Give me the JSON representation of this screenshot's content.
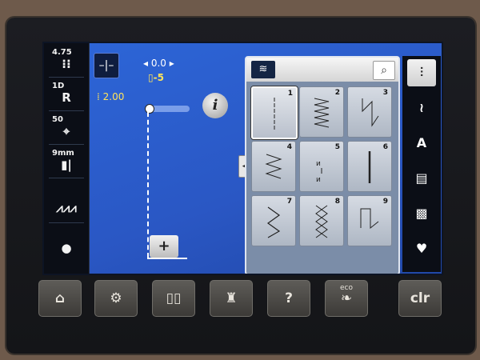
{
  "left_panel": {
    "stitch_length_value": "4.75",
    "stitch_length_glyph": "⁝⁝",
    "foot_value": "1D",
    "foot_glyph": "R",
    "tension_value": "50",
    "tension_glyph": "⌖",
    "needle_value": "9mm",
    "needle_glyph": "▮|",
    "feed_glyph": "⩘⩘⩘",
    "bobbin_glyph": "●"
  },
  "main": {
    "needle_position_label": "◂ 0.0 ▸",
    "length_marker": "▯-5",
    "width_value": "2.00",
    "info_label": "i",
    "plus_label": "+"
  },
  "stitch_panel": {
    "header_icon": "≋",
    "search_icon": "search-icon",
    "cells": [
      {
        "num": "1",
        "type": "straight"
      },
      {
        "num": "2",
        "type": "zigzag"
      },
      {
        "num": "3",
        "type": "blind"
      },
      {
        "num": "4",
        "type": "wave"
      },
      {
        "num": "5",
        "type": "bar"
      },
      {
        "num": "6",
        "type": "triple"
      },
      {
        "num": "7",
        "type": "zig"
      },
      {
        "num": "8",
        "type": "cross"
      },
      {
        "num": "9",
        "type": "blindhem"
      }
    ]
  },
  "right_panel": {
    "items": [
      "⫶",
      "≀",
      "A",
      "▤",
      "▩",
      "♥"
    ]
  },
  "hardware_buttons": {
    "home": "⌂",
    "settings": "⚙",
    "guide": "▯▯",
    "mannequin": "♜",
    "help": "?",
    "eco_label": "eco",
    "eco_glyph": "❧",
    "clear": "clr"
  },
  "colors": {
    "screen_blue": "#2a57c4",
    "accent_yellow": "#ffe45a"
  }
}
